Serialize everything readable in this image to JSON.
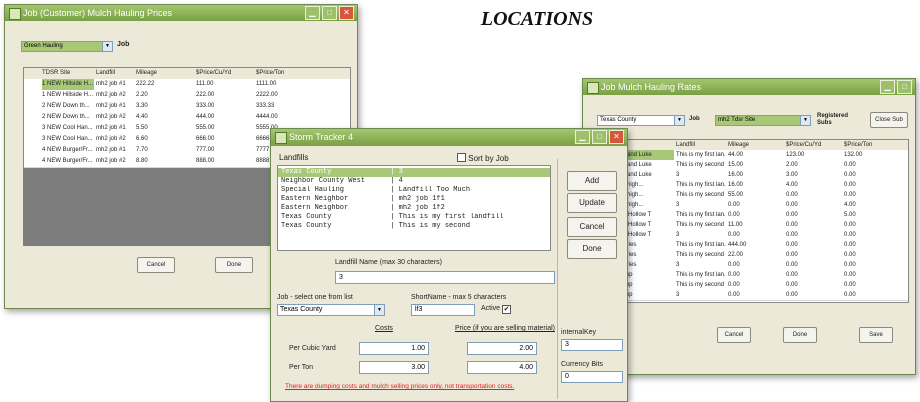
{
  "heading": "LOCATIONS",
  "win1": {
    "title": "Job (Customer) Mulch Hauling Prices",
    "select_value": "Green Hauling",
    "job_label": "Job",
    "columns": [
      "TDSR Site",
      "Landfill",
      "Mileage",
      "$Price/Cu/Yd",
      "$Price/Ton"
    ],
    "rows": [
      [
        "1 NEW Hillside H...",
        "mh2 job #1",
        "222.22",
        "111.00",
        "1111.00"
      ],
      [
        "1 NEW Hillside H...",
        "mh2 job #2",
        "2.20",
        "222.00",
        "2222.00"
      ],
      [
        "2 NEW Down th...",
        "mh2 job #1",
        "3.30",
        "333.00",
        "333.33"
      ],
      [
        "2 NEW Down th...",
        "mh2 job #2",
        "4.40",
        "444.00",
        "4444.00"
      ],
      [
        "3 NEW Cool Han...",
        "mh2 job #1",
        "5.50",
        "555.00",
        "5555.00"
      ],
      [
        "3 NEW Cool Han...",
        "mh2 job #2",
        "6.60",
        "666.00",
        "6666.00"
      ],
      [
        "4 NEW Burger/Fr...",
        "mh2 job #1",
        "7.70",
        "777.00",
        "7777.00"
      ],
      [
        "4 NEW Burger/Fr...",
        "mh2 job #2",
        "8.80",
        "888.00",
        "8888.00"
      ]
    ],
    "cancel": "Cancel",
    "done": "Done"
  },
  "win2": {
    "title": "Storm Tracker 4",
    "landfills_label": "Landfills",
    "sort_label": "Sort by Job",
    "list": [
      "Texas County              | 3",
      "Neighbor County West      | 4",
      "Special Hauling           | Landfill Too Much",
      "Eastern Neighbor          | mh2 job 1f1",
      "Eastern Neighbor          | mh2 job 1f2",
      "Texas County              | This is my first landfill",
      "Texas County              | This is my second"
    ],
    "add": "Add",
    "update": "Update",
    "cancel": "Cancel",
    "done": "Done",
    "landfill_name_label": "Landfill Name (max 30 characters)",
    "landfill_name_value": "3",
    "job_label": "Job - select one from list",
    "job_value": "Texas County",
    "shortname_label": "ShortName - max 5 characters",
    "shortname_value": "lf3",
    "active_label": "Active",
    "costs_label": "Costs",
    "price_label": "Price (if you are selling material)",
    "per_cubic_yard": "Per Cubic Yard",
    "per_ton": "Per Ton",
    "cost_cy": "1.00",
    "cost_ton": "3.00",
    "price_cy": "2.00",
    "price_ton": "4.00",
    "internal_key_label": "internalKey",
    "internal_key_value": "3",
    "currency_label": "Currency Bits",
    "currency_value": "0",
    "note": "There are dumping costs and mulch selling prices only, not transportation costs."
  },
  "win3": {
    "title": "Job Mulch Hauling Rates",
    "county_value": "Texas County",
    "job_label": "Job",
    "job_select_value": "mh2 Tdsr Site",
    "registered_label": "Registered Subs",
    "close_sub": "Close Sub",
    "columns": [
      "TDSR Site",
      "Landfill",
      "Mileage",
      "$Price/Cu/Yd",
      "$Price/Ton"
    ],
    "rows": [
      [
        "Hillside H/and Luke",
        "This is my first lan...",
        "44.00",
        "123.00",
        "132.00"
      ],
      [
        "Hillside H/and Luke",
        "This is my second",
        "15.00",
        "2.00",
        "0.00"
      ],
      [
        "Hillside H/and Luke",
        "3",
        "16.00",
        "3.00",
        "0.00"
      ],
      [
        "Down the high...",
        "This is my first lan...",
        "16.00",
        "4.00",
        "0.00"
      ],
      [
        "Down the high...",
        "This is my second",
        "55.00",
        "0.00",
        "0.00"
      ],
      [
        "Down the high...",
        "3",
        "0.00",
        "0.00",
        "4.00"
      ],
      [
        "Cool Hide Hollow T",
        "This is my first lan...",
        "0.00",
        "0.00",
        "5.00"
      ],
      [
        "Cool Hide Hollow T",
        "This is my second",
        "11.00",
        "0.00",
        "0.00"
      ],
      [
        "Cool Hide Hollow T",
        "3",
        "0.00",
        "0.00",
        "0.00"
      ],
      [
        "Burger / Fries",
        "This is my first lan...",
        "444.00",
        "0.00",
        "0.00"
      ],
      [
        "Burger / Fries",
        "This is my second",
        "22.00",
        "0.00",
        "0.00"
      ],
      [
        "Burger / Fries",
        "3",
        "0.00",
        "0.00",
        "0.00"
      ],
      [
        "Cuz's Dump",
        "This is my first lan...",
        "0.00",
        "0.00",
        "0.00"
      ],
      [
        "Cuz's Dump",
        "This is my second",
        "0.00",
        "0.00",
        "0.00"
      ],
      [
        "Cuz's Dump",
        "3",
        "0.00",
        "0.00",
        "0.00"
      ]
    ],
    "cancel": "Cancel",
    "done": "Done",
    "save": "Save"
  }
}
